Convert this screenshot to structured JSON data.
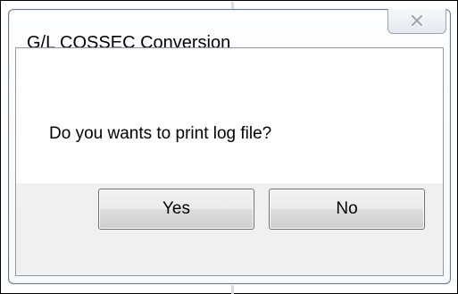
{
  "dialog": {
    "title": "G/L COSSEC Conversion",
    "close_icon": "close-x-icon",
    "message": "Do you wants to print log file?",
    "buttons": {
      "yes_label": "Yes",
      "no_label": "No"
    }
  },
  "colors": {
    "button_panel": "#f0f0f0",
    "window_border": "#6c7a8a",
    "text": "#000000"
  }
}
